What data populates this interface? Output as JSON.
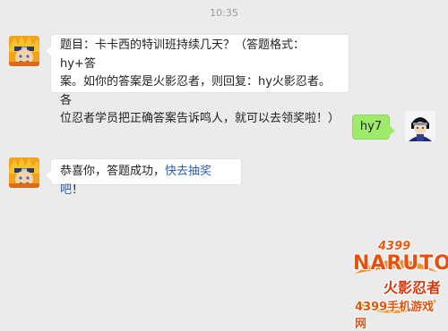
{
  "chat": {
    "timestamp": "10:35",
    "messages": [
      {
        "sender": "bot",
        "text": "题目：卡卡西的特训班持续几天？（答题格式：hy+答案。如你的答案是火影忍者，则回复：hy火影忍者。各位忍者学员把正确答案告诉鸣人，就可以去领奖啦！）",
        "lines": [
          "题目：卡卡西的特训班持续几天？（答题格式：hy+答",
          "案。如你的答案是火影忍者，则回复：hy火影忍者。各",
          "位忍者学员把正确答案告诉鸣人，就可以去领奖啦！）"
        ]
      },
      {
        "sender": "user",
        "text": "hy7"
      },
      {
        "sender": "bot",
        "text_prefix": "恭喜你，答题成功，",
        "link_text": "快去抽奖吧",
        "text_suffix": "！"
      }
    ]
  },
  "watermark": {
    "number": "4399",
    "brand": "NARUTO",
    "title": "火影忍者",
    "subtitle": "4399手机游戏网"
  },
  "colors": {
    "background": "#ebebeb",
    "user_bubble": "#9eea6a",
    "bot_bubble": "#ffffff",
    "link": "#2a5fb0"
  },
  "icons": {
    "bot_avatar": "naruto-avatar-icon",
    "user_avatar": "ninja-avatar-icon"
  }
}
